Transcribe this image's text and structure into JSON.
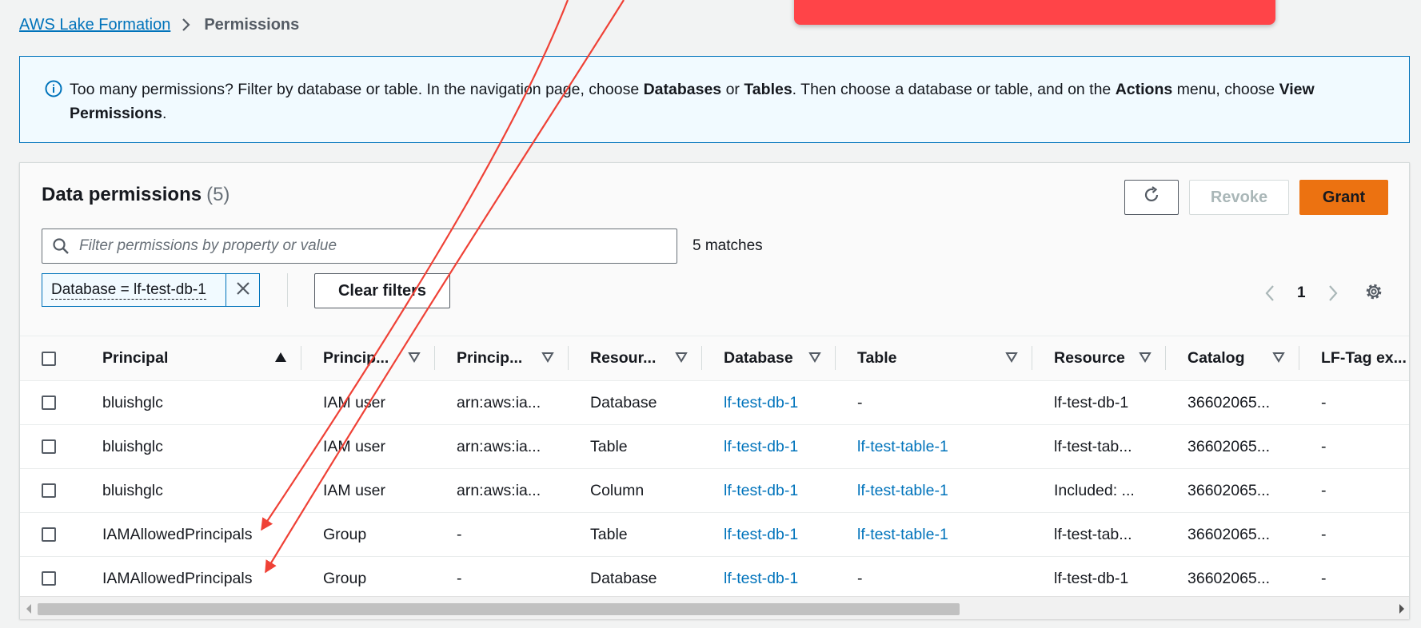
{
  "breadcrumb": {
    "root": "AWS Lake Formation",
    "current": "Permissions"
  },
  "info": {
    "segments": [
      {
        "t": "Too many permissions? Filter by database or table. In the navigation page, choose ",
        "b": false
      },
      {
        "t": "Databases",
        "b": true
      },
      {
        "t": " or ",
        "b": false
      },
      {
        "t": "Tables",
        "b": true
      },
      {
        "t": ". Then choose a database or table, and on the ",
        "b": false
      },
      {
        "t": "Actions",
        "b": true
      },
      {
        "t": " menu, choose ",
        "b": false
      },
      {
        "t": "View Permissions",
        "b": true
      },
      {
        "t": ".",
        "b": false
      }
    ]
  },
  "panel": {
    "title": "Data permissions",
    "count": "(5)",
    "revoke_label": "Revoke",
    "grant_label": "Grant",
    "search_placeholder": "Filter permissions by property or value",
    "matches": "5 matches",
    "filter_token": "Database = lf-test-db-1",
    "clear_filters": "Clear filters",
    "page": "1"
  },
  "table": {
    "columns": [
      {
        "label": "Principal",
        "sort": "asc"
      },
      {
        "label": "Princip...",
        "sort": "none"
      },
      {
        "label": "Princip...",
        "sort": "none"
      },
      {
        "label": "Resour...",
        "sort": "none"
      },
      {
        "label": "Database",
        "sort": "none"
      },
      {
        "label": "Table",
        "sort": "none"
      },
      {
        "label": "Resource",
        "sort": "none"
      },
      {
        "label": "Catalog",
        "sort": "none"
      },
      {
        "label": "LF-Tag ex...",
        "sort": "none"
      }
    ],
    "rows": [
      [
        "bluishglc",
        "IAM user",
        "arn:aws:ia...",
        "Database",
        "lf-test-db-1",
        "-",
        "lf-test-db-1",
        "36602065...",
        "-"
      ],
      [
        "bluishglc",
        "IAM user",
        "arn:aws:ia...",
        "Table",
        "lf-test-db-1",
        "lf-test-table-1",
        "lf-test-tab...",
        "36602065...",
        "-"
      ],
      [
        "bluishglc",
        "IAM user",
        "arn:aws:ia...",
        "Column",
        "lf-test-db-1",
        "lf-test-table-1",
        "Included: ...",
        "36602065...",
        "-"
      ],
      [
        "IAMAllowedPrincipals",
        "Group",
        "-",
        "Table",
        "lf-test-db-1",
        "lf-test-table-1",
        "lf-test-tab...",
        "36602065...",
        "-"
      ],
      [
        "IAMAllowedPrincipals",
        "Group",
        "-",
        "Database",
        "lf-test-db-1",
        "-",
        "lf-test-db-1",
        "36602065...",
        "-"
      ]
    ],
    "link_columns": [
      4,
      5
    ]
  },
  "colors": {
    "link": "#0073bb",
    "grant": "#ec7211",
    "annotation_red": "#ef4136",
    "banner_red": "#ff4448"
  },
  "icons": [
    "info-icon",
    "chevron-right-icon",
    "refresh-icon",
    "search-icon",
    "close-icon",
    "chevron-left-icon",
    "settings-gear-icon",
    "sort-asc-icon",
    "sort-desc-icon"
  ]
}
